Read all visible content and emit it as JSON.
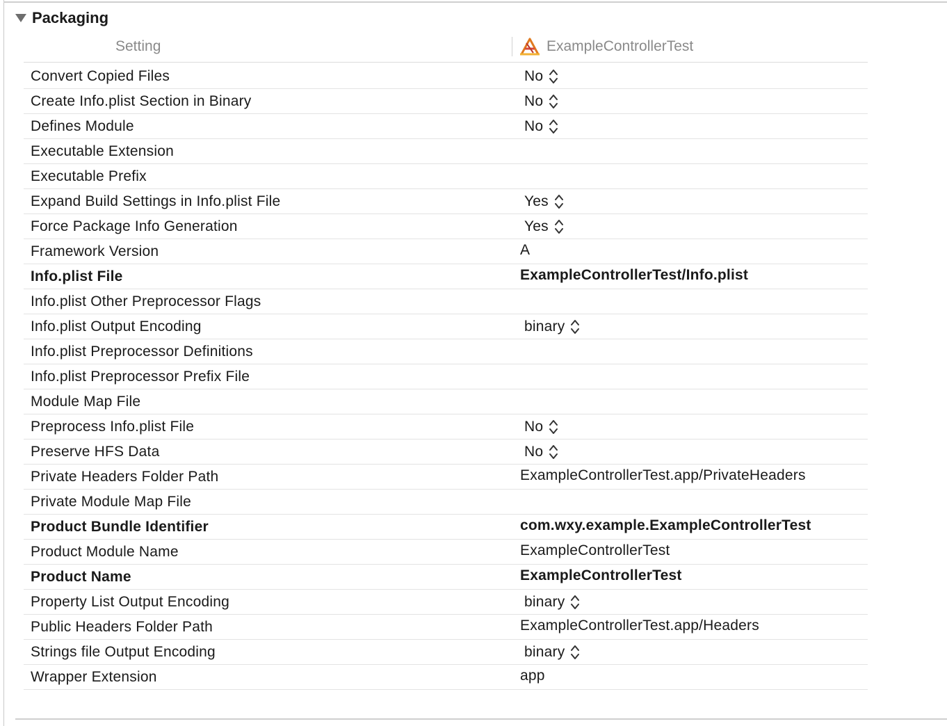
{
  "section": {
    "title": "Packaging",
    "icon": "disclosure-triangle-open-icon"
  },
  "columns": {
    "setting": "Setting",
    "target": "ExampleControllerTest",
    "target_icon": "xcode-app-target-icon"
  },
  "rows": [
    {
      "label": "Convert Copied Files",
      "value": "No",
      "popup": true,
      "bold": false
    },
    {
      "label": "Create Info.plist Section in Binary",
      "value": "No",
      "popup": true,
      "bold": false
    },
    {
      "label": "Defines Module",
      "value": "No",
      "popup": true,
      "bold": false
    },
    {
      "label": "Executable Extension",
      "value": "",
      "popup": false,
      "bold": false
    },
    {
      "label": "Executable Prefix",
      "value": "",
      "popup": false,
      "bold": false
    },
    {
      "label": "Expand Build Settings in Info.plist File",
      "value": "Yes",
      "popup": true,
      "bold": false
    },
    {
      "label": "Force Package Info Generation",
      "value": "Yes",
      "popup": true,
      "bold": false
    },
    {
      "label": "Framework Version",
      "value": "A",
      "popup": false,
      "bold": false
    },
    {
      "label": "Info.plist File",
      "value": "ExampleControllerTest/Info.plist",
      "popup": false,
      "bold": true
    },
    {
      "label": "Info.plist Other Preprocessor Flags",
      "value": "",
      "popup": false,
      "bold": false
    },
    {
      "label": "Info.plist Output Encoding",
      "value": "binary",
      "popup": true,
      "bold": false
    },
    {
      "label": "Info.plist Preprocessor Definitions",
      "value": "",
      "popup": false,
      "bold": false
    },
    {
      "label": "Info.plist Preprocessor Prefix File",
      "value": "",
      "popup": false,
      "bold": false
    },
    {
      "label": "Module Map File",
      "value": "",
      "popup": false,
      "bold": false
    },
    {
      "label": "Preprocess Info.plist File",
      "value": "No",
      "popup": true,
      "bold": false
    },
    {
      "label": "Preserve HFS Data",
      "value": "No",
      "popup": true,
      "bold": false
    },
    {
      "label": "Private Headers Folder Path",
      "value": "ExampleControllerTest.app/PrivateHeaders",
      "popup": false,
      "bold": false
    },
    {
      "label": "Private Module Map File",
      "value": "",
      "popup": false,
      "bold": false
    },
    {
      "label": "Product Bundle Identifier",
      "value": "com.wxy.example.ExampleControllerTest",
      "popup": false,
      "bold": true
    },
    {
      "label": "Product Module Name",
      "value": "ExampleControllerTest",
      "popup": false,
      "bold": false
    },
    {
      "label": "Product Name",
      "value": "ExampleControllerTest",
      "popup": false,
      "bold": true
    },
    {
      "label": "Property List Output Encoding",
      "value": "binary",
      "popup": true,
      "bold": false
    },
    {
      "label": "Public Headers Folder Path",
      "value": "ExampleControllerTest.app/Headers",
      "popup": false,
      "bold": false
    },
    {
      "label": "Strings file Output Encoding",
      "value": "binary",
      "popup": true,
      "bold": false
    },
    {
      "label": "Wrapper Extension",
      "value": "app",
      "popup": false,
      "bold": false
    }
  ],
  "popup_icon": "up-down-chevron-icon"
}
